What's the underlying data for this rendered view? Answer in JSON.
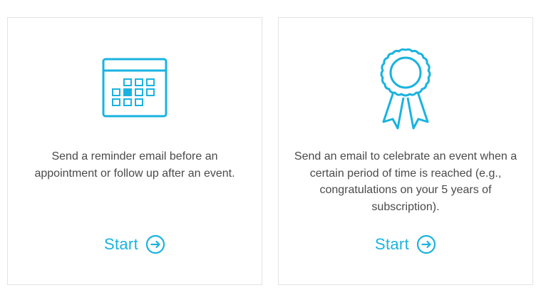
{
  "accent_color": "#1ab3e0",
  "cards": [
    {
      "icon": "calendar-icon",
      "description": "Send a reminder email before an appointment or follow up after an event.",
      "cta_label": "Start",
      "cta_icon": "arrow-right-circle-icon"
    },
    {
      "icon": "award-ribbon-icon",
      "description": "Send an email to celebrate an event when a certain period of time is reached (e.g., congratulations on your 5 years of subscription).",
      "cta_label": "Start",
      "cta_icon": "arrow-right-circle-icon"
    }
  ]
}
